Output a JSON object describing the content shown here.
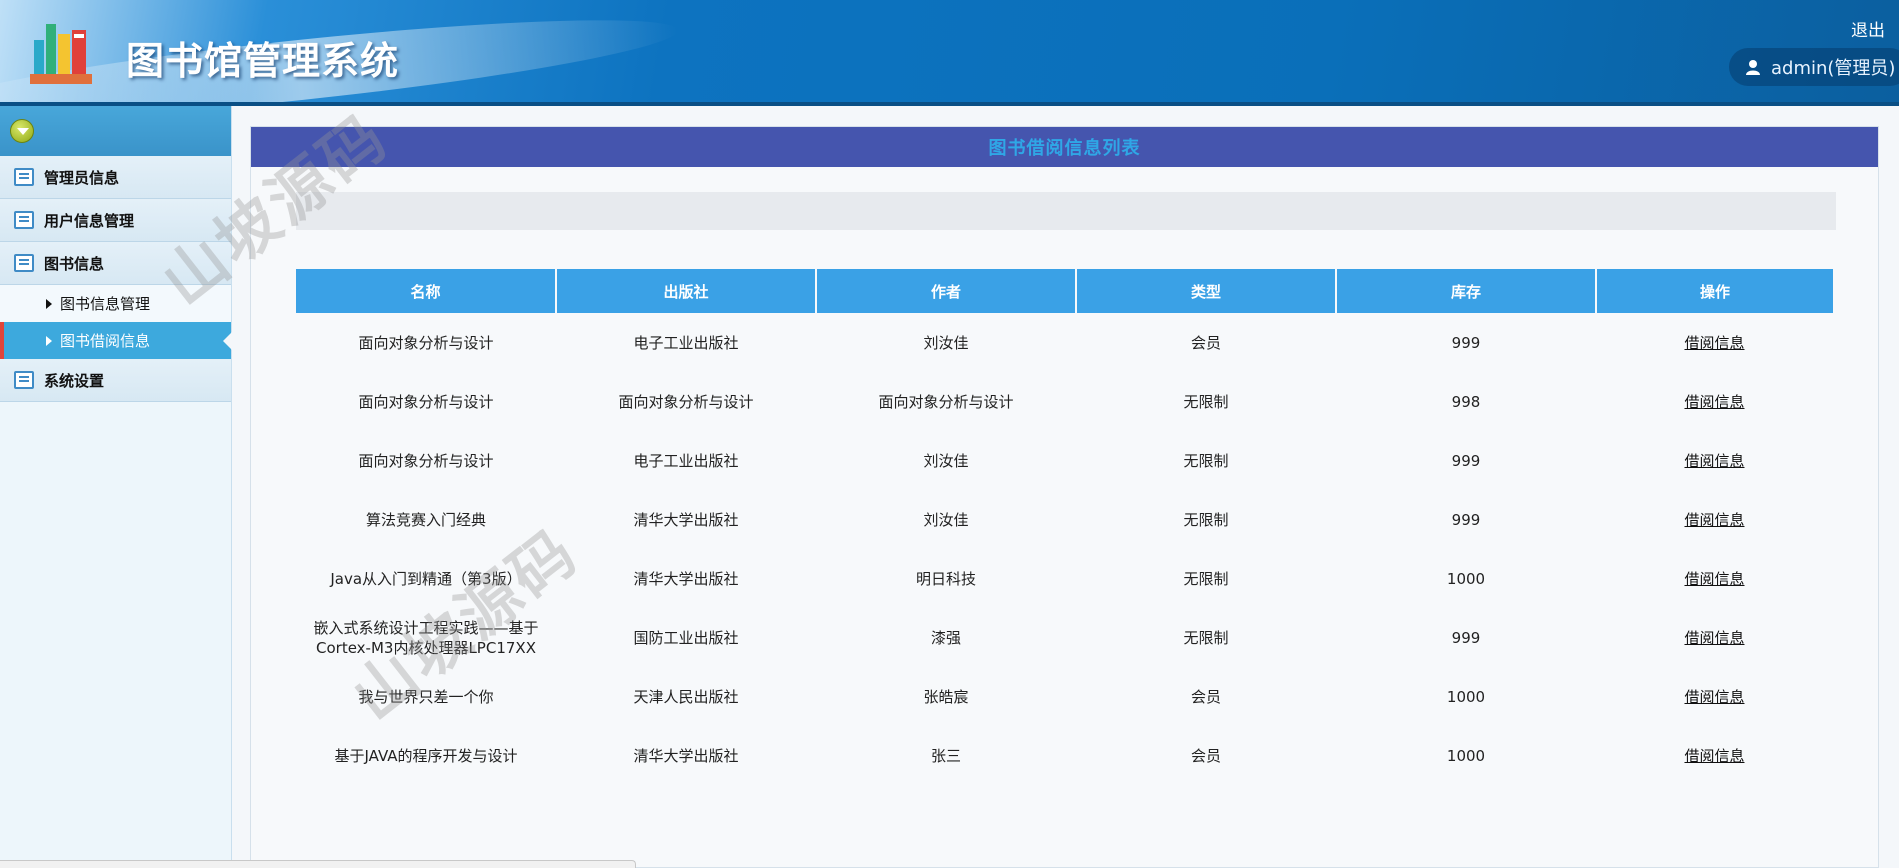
{
  "header": {
    "title": "图书馆管理系统",
    "logout_label": "退出",
    "user_label": "admin(管理员)"
  },
  "sidebar": {
    "items": [
      {
        "label": "管理员信息"
      },
      {
        "label": "用户信息管理"
      },
      {
        "label": "图书信息",
        "children": [
          {
            "label": "图书信息管理"
          },
          {
            "label": "图书借阅信息",
            "active": true
          }
        ]
      },
      {
        "label": "系统设置"
      }
    ]
  },
  "panel": {
    "title": "图书借阅信息列表"
  },
  "table": {
    "headers": [
      "名称",
      "出版社",
      "作者",
      "类型",
      "库存",
      "操作"
    ],
    "rows": [
      {
        "name": "面向对象分析与设计",
        "publisher": "电子工业出版社",
        "author": "刘汝佳",
        "type": "会员",
        "stock": "999",
        "action": "借阅信息"
      },
      {
        "name": "面向对象分析与设计",
        "publisher": "面向对象分析与设计",
        "author": "面向对象分析与设计",
        "type": "无限制",
        "stock": "998",
        "action": "借阅信息"
      },
      {
        "name": "面向对象分析与设计",
        "publisher": "电子工业出版社",
        "author": "刘汝佳",
        "type": "无限制",
        "stock": "999",
        "action": "借阅信息"
      },
      {
        "name": "算法竞赛入门经典",
        "publisher": "清华大学出版社",
        "author": "刘汝佳",
        "type": "无限制",
        "stock": "999",
        "action": "借阅信息"
      },
      {
        "name": "Java从入门到精通（第3版）",
        "publisher": "清华大学出版社",
        "author": "明日科技",
        "type": "无限制",
        "stock": "1000",
        "action": "借阅信息"
      },
      {
        "name": "嵌入式系统设计工程实践——基于Cortex-M3内核处理器LPC17XX",
        "publisher": "国防工业出版社",
        "author": "漆强",
        "type": "无限制",
        "stock": "999",
        "action": "借阅信息"
      },
      {
        "name": "我与世界只差一个你",
        "publisher": "天津人民出版社",
        "author": "张皓宸",
        "type": "会员",
        "stock": "1000",
        "action": "借阅信息"
      },
      {
        "name": "基于JAVA的程序开发与设计",
        "publisher": "清华大学出版社",
        "author": "张三",
        "type": "会员",
        "stock": "1000",
        "action": "借阅信息"
      }
    ]
  },
  "watermark": {
    "text": "山坡源码"
  },
  "colors": {
    "header_blue": "#0a6fb9",
    "title_bar": "#4555ae",
    "title_text": "#2fa7e6",
    "table_header": "#3aa1e6",
    "active_item": "#3da9dd"
  },
  "icons": [
    "books-logo-icon",
    "user-icon",
    "menu-toggle-icon",
    "list-icon",
    "caret-right-icon"
  ]
}
